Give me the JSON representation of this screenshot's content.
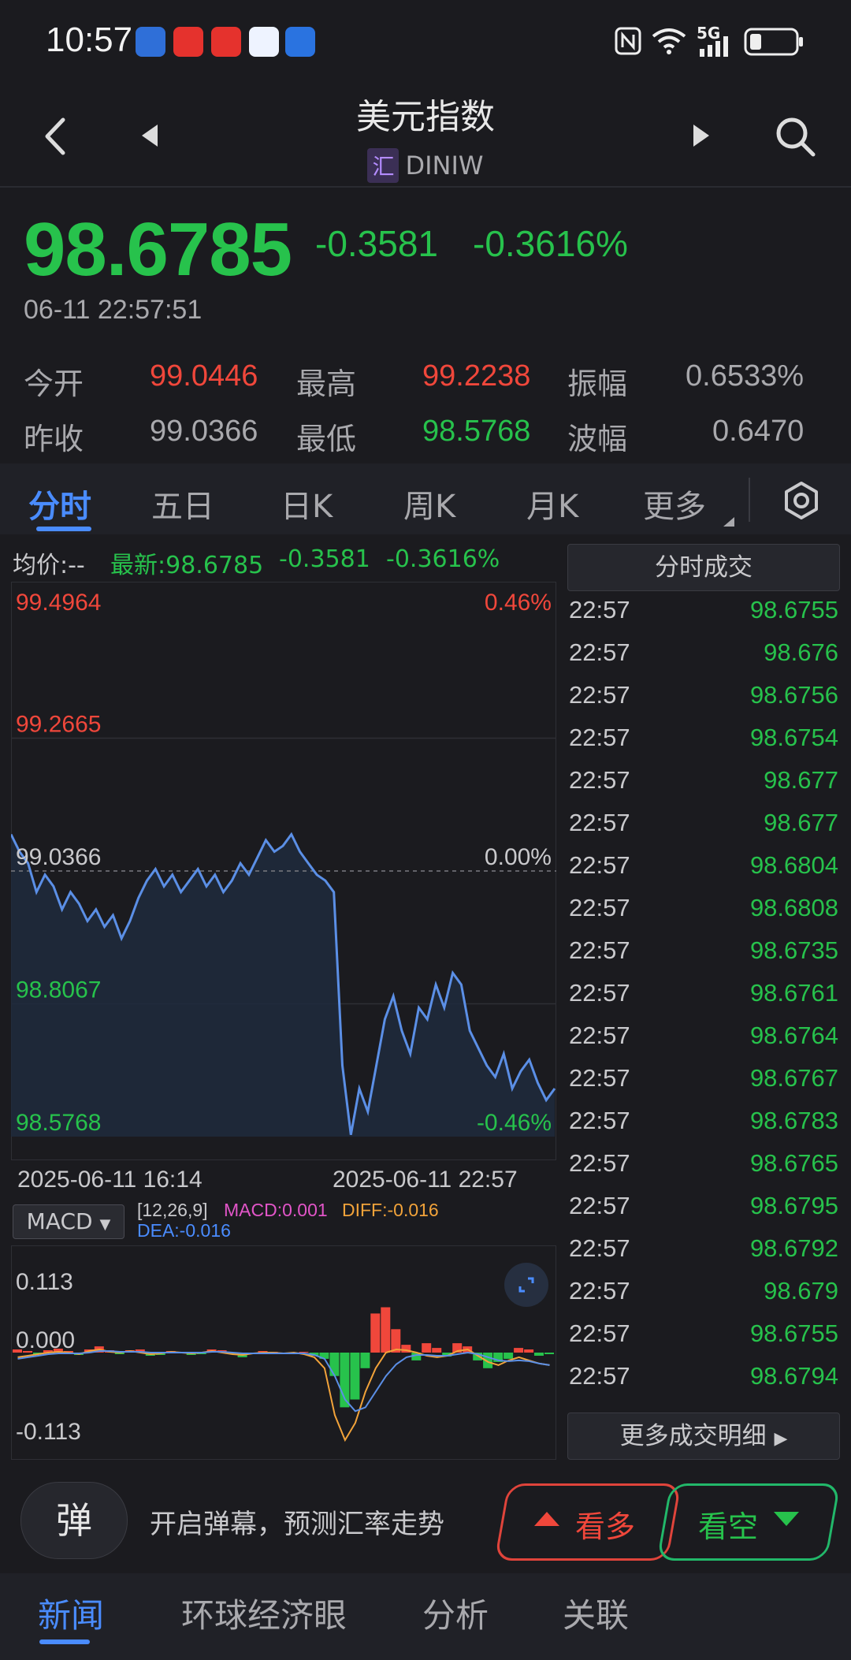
{
  "status_bar": {
    "time": "10:57",
    "network": "5G"
  },
  "header": {
    "title": "美元指数",
    "badge": "汇",
    "code": "DINIW"
  },
  "quote": {
    "price": "98.6785",
    "change": "-0.3581",
    "change_pct": "-0.3616%",
    "timestamp": "06-11 22:57:51",
    "stats": [
      {
        "label": "今开",
        "value": "99.0446",
        "color": "red"
      },
      {
        "label": "最高",
        "value": "99.2238",
        "color": "red"
      },
      {
        "label": "振幅",
        "value": "0.6533%",
        "color": "grey"
      },
      {
        "label": "昨收",
        "value": "99.0366",
        "color": "grey"
      },
      {
        "label": "最低",
        "value": "98.5768",
        "color": "green"
      },
      {
        "label": "波幅",
        "value": "0.6470",
        "color": "grey"
      }
    ]
  },
  "tabs": [
    "分时",
    "五日",
    "日K",
    "周K",
    "月K",
    "更多"
  ],
  "chart_legend": {
    "avg": "均价:--",
    "latest": "最新:98.6785",
    "change": "-0.3581",
    "change_pct": "-0.3616%"
  },
  "chart_data": [
    {
      "type": "line",
      "ylim": [
        98.5768,
        99.4964
      ],
      "y_ticks_left": [
        "99.4964",
        "99.2665",
        "99.0366",
        "98.8067",
        "98.5768"
      ],
      "y_ticks_right": [
        "0.46%",
        "0.00%",
        "-0.46%"
      ],
      "x_labels": [
        "2025-06-11 16:14",
        "2025-06-11 22:57"
      ],
      "reference": 99.0366,
      "series": [
        {
          "values": [
            99.1,
            99.07,
            99.05,
            99.0,
            99.03,
            99.01,
            98.97,
            99.0,
            98.98,
            98.95,
            98.97,
            98.94,
            98.96,
            98.92,
            98.95,
            98.99,
            99.02,
            99.04,
            99.01,
            99.03,
            99.0,
            99.02,
            99.04,
            99.01,
            99.03,
            99.0,
            99.02,
            99.05,
            99.03,
            99.06,
            99.09,
            99.07,
            99.08,
            99.1,
            99.07,
            99.05,
            99.03,
            99.02,
            99.0,
            98.7,
            98.58,
            98.66,
            98.62,
            98.7,
            98.78,
            98.82,
            98.76,
            98.72,
            98.8,
            98.78,
            98.84,
            98.8,
            98.86,
            98.84,
            98.76,
            98.73,
            98.7,
            98.68,
            98.72,
            98.66,
            98.69,
            98.71,
            98.67,
            98.64,
            98.66
          ]
        }
      ]
    },
    {
      "type": "bar",
      "title": "MACD",
      "params": "[12,26,9]",
      "ylim": [
        -0.113,
        0.113
      ],
      "y_ticks": [
        "0.113",
        "0.000",
        "-0.113"
      ],
      "legend": {
        "macd": "MACD:0.001",
        "diff": "DIFF:-0.016",
        "dea": "DEA:-0.016"
      },
      "series": [
        {
          "name": "MACD",
          "values": [
            0.004,
            0.002,
            -0.002,
            0.003,
            0.005,
            0.002,
            -0.003,
            0.004,
            0.008,
            0.003,
            -0.002,
            0.003,
            0.004,
            -0.004,
            -0.003,
            0.002,
            0.001,
            -0.003,
            -0.002,
            0.004,
            0.003,
            -0.002,
            -0.006,
            -0.002,
            0.002,
            0.001,
            -0.002,
            -0.001,
            0.001,
            -0.004,
            -0.008,
            -0.03,
            -0.07,
            -0.06,
            -0.02,
            0.05,
            0.058,
            0.03,
            0.01,
            -0.01,
            0.012,
            0.006,
            -0.005,
            0.012,
            0.008,
            -0.01,
            -0.02,
            -0.012,
            -0.008,
            0.006,
            0.004,
            -0.004,
            -0.002
          ]
        },
        {
          "name": "DIFF",
          "values": [
            -0.006,
            -0.004,
            -0.002,
            0.0,
            0.001,
            0.0,
            -0.002,
            0.002,
            0.004,
            0.001,
            0.0,
            0.002,
            0.0,
            -0.002,
            -0.001,
            0.001,
            0.0,
            -0.001,
            0.0,
            0.002,
            0.0,
            -0.002,
            -0.003,
            -0.001,
            0.0,
            0.0,
            -0.001,
            0.0,
            -0.002,
            -0.006,
            -0.02,
            -0.08,
            -0.112,
            -0.09,
            -0.05,
            -0.02,
            0.0,
            0.004,
            0.003,
            0.0,
            -0.004,
            -0.006,
            -0.004,
            0.002,
            0.004,
            -0.004,
            -0.012,
            -0.016,
            -0.01,
            -0.006,
            -0.01,
            -0.014,
            -0.016
          ]
        },
        {
          "name": "DEA",
          "values": [
            -0.008,
            -0.006,
            -0.004,
            -0.002,
            -0.001,
            -0.001,
            -0.001,
            0.0,
            0.002,
            0.002,
            0.001,
            0.001,
            0.001,
            0.0,
            0.0,
            0.0,
            0.0,
            0.0,
            0.0,
            0.001,
            0.001,
            0.0,
            -0.001,
            -0.001,
            -0.001,
            -0.001,
            -0.001,
            -0.001,
            -0.001,
            -0.003,
            -0.008,
            -0.03,
            -0.06,
            -0.075,
            -0.07,
            -0.05,
            -0.03,
            -0.015,
            -0.006,
            -0.003,
            -0.003,
            -0.004,
            -0.004,
            -0.002,
            0.0,
            -0.002,
            -0.006,
            -0.01,
            -0.011,
            -0.01,
            -0.011,
            -0.014,
            -0.016
          ]
        }
      ]
    }
  ],
  "trades": {
    "header": "分时成交",
    "rows": [
      {
        "time": "22:57",
        "price": "98.6755"
      },
      {
        "time": "22:57",
        "price": "98.676"
      },
      {
        "time": "22:57",
        "price": "98.6756"
      },
      {
        "time": "22:57",
        "price": "98.6754"
      },
      {
        "time": "22:57",
        "price": "98.677"
      },
      {
        "time": "22:57",
        "price": "98.677"
      },
      {
        "time": "22:57",
        "price": "98.6804"
      },
      {
        "time": "22:57",
        "price": "98.6808"
      },
      {
        "time": "22:57",
        "price": "98.6735"
      },
      {
        "time": "22:57",
        "price": "98.6761"
      },
      {
        "time": "22:57",
        "price": "98.6764"
      },
      {
        "time": "22:57",
        "price": "98.6767"
      },
      {
        "time": "22:57",
        "price": "98.6783"
      },
      {
        "time": "22:57",
        "price": "98.6765"
      },
      {
        "time": "22:57",
        "price": "98.6795"
      },
      {
        "time": "22:57",
        "price": "98.6792"
      },
      {
        "time": "22:57",
        "price": "98.679"
      },
      {
        "time": "22:57",
        "price": "98.6755"
      },
      {
        "time": "22:57",
        "price": "98.6794"
      }
    ],
    "more_label": "更多成交明细"
  },
  "macd_selector": "MACD",
  "action_bar": {
    "danmu_icon": "弹",
    "danmu_text": "开启弹幕，预测汇率走势",
    "bull_label": "看多",
    "bear_label": "看空"
  },
  "bottom_tabs": [
    "新闻",
    "环球经济眼",
    "分析",
    "关联"
  ],
  "colors": {
    "up": "#f0473b",
    "down": "#27c24c",
    "accent": "#4a8cff",
    "line": "#5b8fe6"
  }
}
